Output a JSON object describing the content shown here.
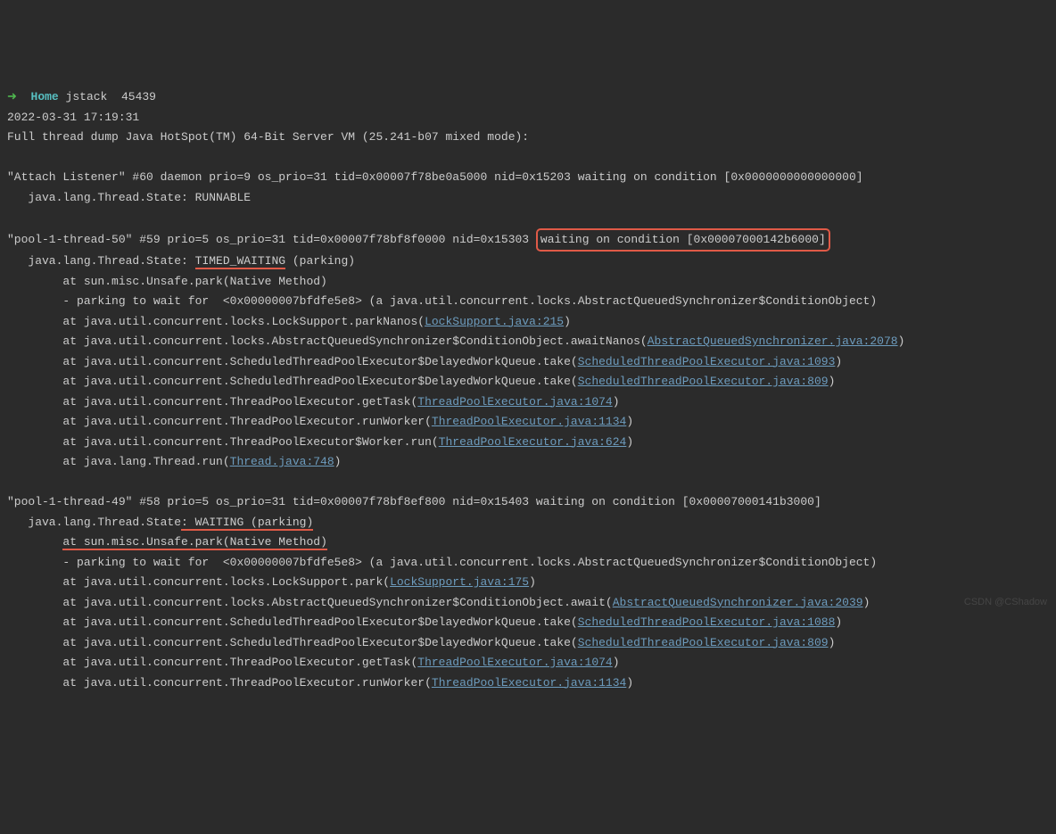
{
  "prompt": {
    "arrow": "➜",
    "cwd": "Home",
    "cmd": "jstack",
    "arg": "45439"
  },
  "header": {
    "timestamp": "2022-03-31 17:19:31",
    "dump": "Full thread dump Java HotSpot(TM) 64-Bit Server VM (25.241-b07 mixed mode):"
  },
  "thread1": {
    "header": "\"Attach Listener\" #60 daemon prio=9 os_prio=31 tid=0x00007f78be0a5000 nid=0x15203 waiting on condition [0x0000000000000000]",
    "state": "   java.lang.Thread.State: RUNNABLE"
  },
  "thread2": {
    "header_before": "\"pool-1-thread-50\" #59 prio=5 os_prio=31 tid=0x00007f78bf8f0000 nid=0x15303 ",
    "header_highlight": "waiting on condition [0x00007000142b6000]",
    "state_before": "   java.lang.Thread.State: ",
    "state_underlined": "TIMED_WAITING",
    "state_after": " (parking)",
    "lines": [
      {
        "indent": "        ",
        "text": "at sun.misc.Unsafe.park(Native Method)",
        "link": null
      },
      {
        "indent": "        ",
        "text": "- parking to wait for  <0x00000007bfdfe5e8> (a java.util.concurrent.locks.AbstractQueuedSynchronizer$ConditionObject)",
        "link": null
      },
      {
        "indent": "        ",
        "text": "at java.util.concurrent.locks.LockSupport.parkNanos(",
        "link": "LockSupport.java:215",
        "after": ")"
      },
      {
        "indent": "        ",
        "text": "at java.util.concurrent.locks.AbstractQueuedSynchronizer$ConditionObject.awaitNanos(",
        "link": "AbstractQueuedSynchronizer.java:2078",
        "after": ")"
      },
      {
        "indent": "        ",
        "text": "at java.util.concurrent.ScheduledThreadPoolExecutor$DelayedWorkQueue.take(",
        "link": "ScheduledThreadPoolExecutor.java:1093",
        "after": ")"
      },
      {
        "indent": "        ",
        "text": "at java.util.concurrent.ScheduledThreadPoolExecutor$DelayedWorkQueue.take(",
        "link": "ScheduledThreadPoolExecutor.java:809",
        "after": ")"
      },
      {
        "indent": "        ",
        "text": "at java.util.concurrent.ThreadPoolExecutor.getTask(",
        "link": "ThreadPoolExecutor.java:1074",
        "after": ")"
      },
      {
        "indent": "        ",
        "text": "at java.util.concurrent.ThreadPoolExecutor.runWorker(",
        "link": "ThreadPoolExecutor.java:1134",
        "after": ")"
      },
      {
        "indent": "        ",
        "text": "at java.util.concurrent.ThreadPoolExecutor$Worker.run(",
        "link": "ThreadPoolExecutor.java:624",
        "after": ")"
      },
      {
        "indent": "        ",
        "text": "at java.lang.Thread.run(",
        "link": "Thread.java:748",
        "after": ")"
      }
    ]
  },
  "thread3": {
    "header": "\"pool-1-thread-49\" #58 prio=5 os_prio=31 tid=0x00007f78bf8ef800 nid=0x15403 waiting on condition [0x00007000141b3000]",
    "state_before": "   java.lang.Thread.State",
    "state_underlined": ": WAITING (parking)",
    "lines": [
      {
        "indent": "        ",
        "text": "at sun.misc.Unsafe.park(Native Method)",
        "link": null,
        "underlined": true
      },
      {
        "indent": "        ",
        "text": "- parking to wait for  <0x00000007bfdfe5e8> (a java.util.concurrent.locks.AbstractQueuedSynchronizer$ConditionObject)",
        "link": null
      },
      {
        "indent": "        ",
        "text": "at java.util.concurrent.locks.LockSupport.park(",
        "link": "LockSupport.java:175",
        "after": ")"
      },
      {
        "indent": "        ",
        "text": "at java.util.concurrent.locks.AbstractQueuedSynchronizer$ConditionObject.await(",
        "link": "AbstractQueuedSynchronizer.java:2039",
        "after": ")"
      },
      {
        "indent": "        ",
        "text": "at java.util.concurrent.ScheduledThreadPoolExecutor$DelayedWorkQueue.take(",
        "link": "ScheduledThreadPoolExecutor.java:1088",
        "after": ")"
      },
      {
        "indent": "        ",
        "text": "at java.util.concurrent.ScheduledThreadPoolExecutor$DelayedWorkQueue.take(",
        "link": "ScheduledThreadPoolExecutor.java:809",
        "after": ")"
      },
      {
        "indent": "        ",
        "text": "at java.util.concurrent.ThreadPoolExecutor.getTask(",
        "link": "ThreadPoolExecutor.java:1074",
        "after": ")"
      },
      {
        "indent": "        ",
        "text": "at java.util.concurrent.ThreadPoolExecutor.runWorker(",
        "link": "ThreadPoolExecutor.java:1134",
        "after": ")"
      }
    ]
  },
  "watermark": "CSDN @CShadow"
}
